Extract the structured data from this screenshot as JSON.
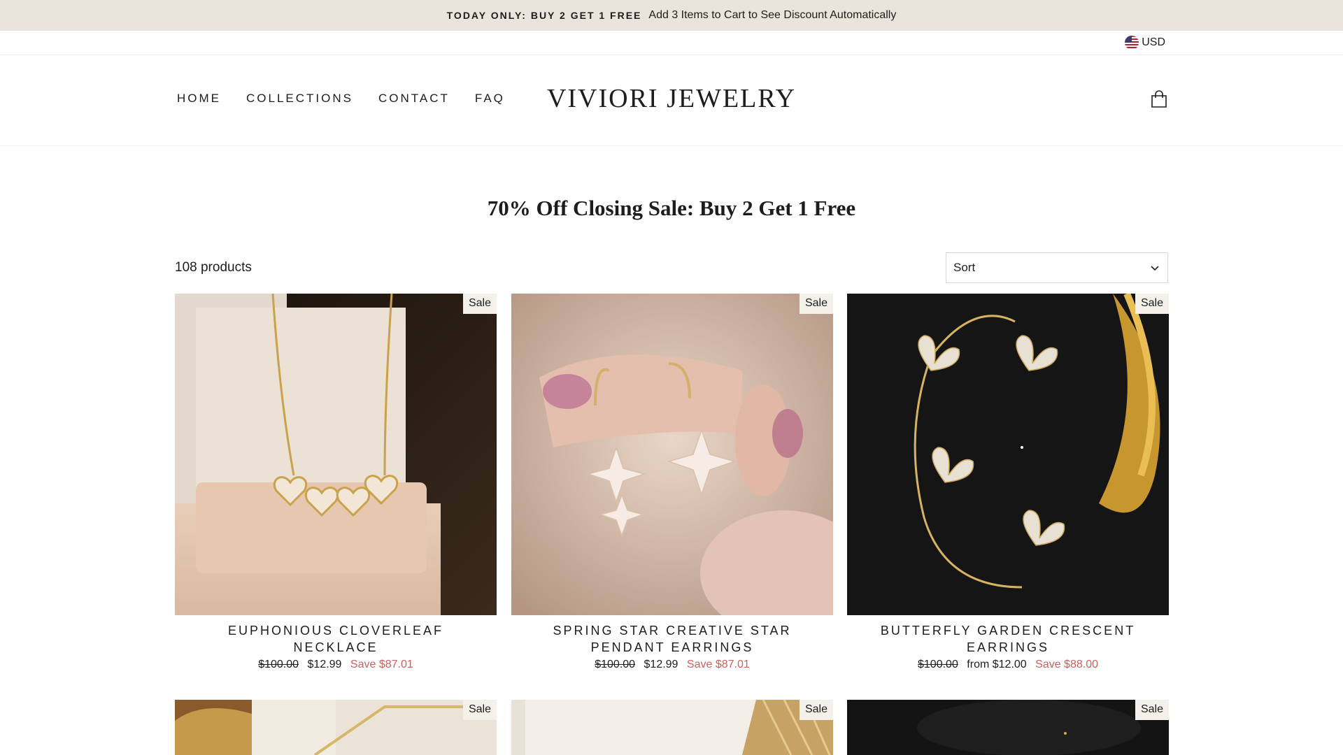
{
  "announcement": {
    "bold": "TODAY ONLY: BUY 2 GET 1 FREE",
    "text": "Add 3 Items to Cart to See Discount Automatically"
  },
  "currency": {
    "label": "USD",
    "icon": "us-flag-icon"
  },
  "nav": {
    "home": "HOME",
    "collections": "COLLECTIONS",
    "contact": "CONTACT",
    "faq": "FAQ"
  },
  "logo": "VIVIORI JEWELRY",
  "cart_icon": "shopping-bag-icon",
  "page_title": "70% Off Closing Sale: Buy 2 Get 1 Free",
  "product_count": "108 products",
  "sort": {
    "label": "Sort",
    "icon": "chevron-down-icon"
  },
  "products": [
    {
      "badge": "Sale",
      "name": "EUPHONIOUS CLOVERLEAF NECKLACE",
      "old_price": "$100.00",
      "price": "$12.99",
      "save": "Save $87.01"
    },
    {
      "badge": "Sale",
      "name": "SPRING STAR CREATIVE STAR PENDANT EARRINGS",
      "old_price": "$100.00",
      "price": "$12.99",
      "save": "Save $87.01"
    },
    {
      "badge": "Sale",
      "name": "BUTTERFLY GARDEN CRESCENT EARRINGS",
      "old_price": "$100.00",
      "price": "from $12.00",
      "save": "Save $88.00"
    },
    {
      "badge": "Sale"
    },
    {
      "badge": "Sale"
    },
    {
      "badge": "Sale"
    }
  ],
  "colors": {
    "announcement_bg": "#ebe4dc",
    "sale_red": "#c9615c",
    "badge_bg": "#f4f0ea"
  }
}
